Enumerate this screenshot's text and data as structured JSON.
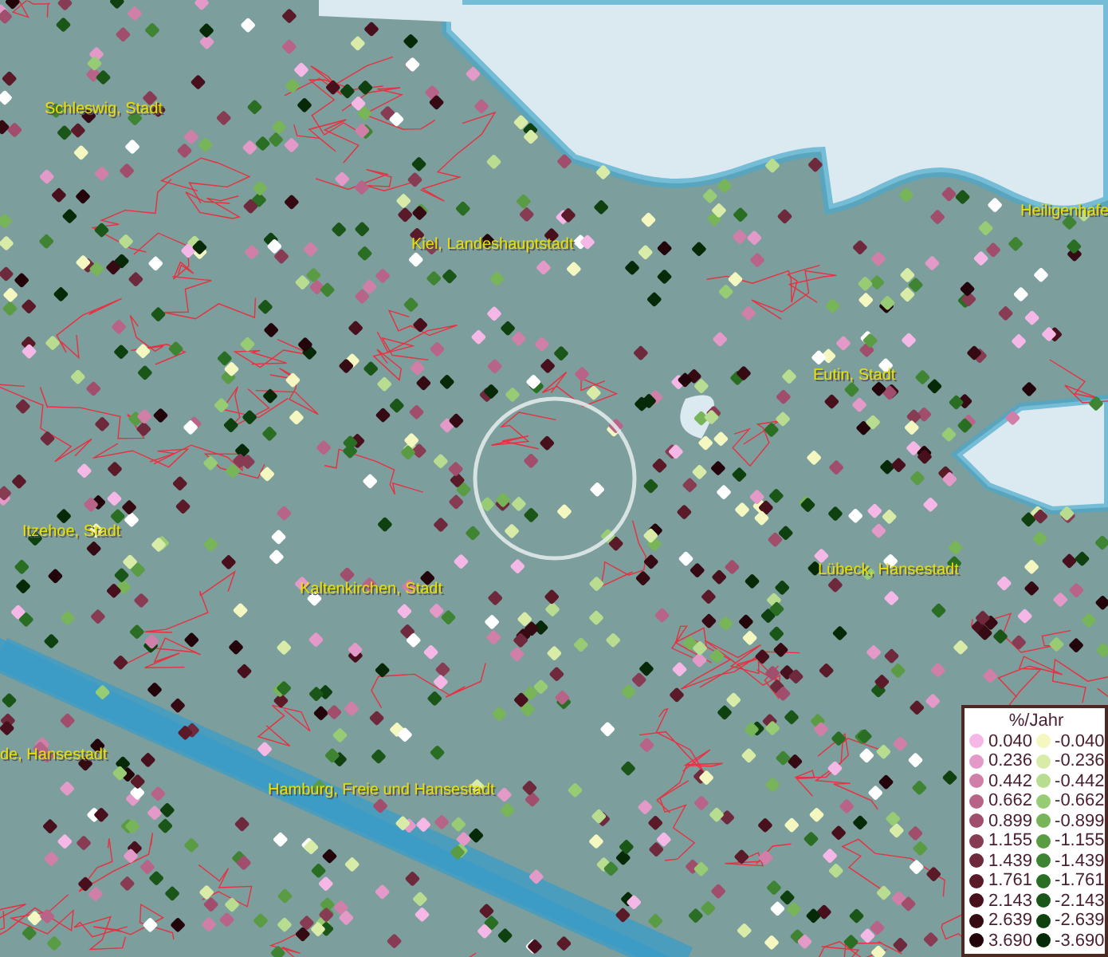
{
  "map": {
    "places": [
      {
        "name": "Schleswig, Stadt"
      },
      {
        "name": "Kiel, Landeshauptstadt"
      },
      {
        "name": "Heiligenhafe"
      },
      {
        "name": "Eutin, Stadt"
      },
      {
        "name": "Itzehoe, Stadt"
      },
      {
        "name": "Kaltenkirchen, Stadt"
      },
      {
        "name": "Lübeck, Hansestadt"
      },
      {
        "name": "de, Hansestadt"
      },
      {
        "name": "Hamburg, Freie und Hansestadt"
      }
    ]
  },
  "legend": {
    "title": "%/Jahr",
    "positive": [
      {
        "value": "0.040",
        "color": "#f5b8e6"
      },
      {
        "value": "0.236",
        "color": "#e49ac8"
      },
      {
        "value": "0.442",
        "color": "#d080a8"
      },
      {
        "value": "0.662",
        "color": "#b86488"
      },
      {
        "value": "0.899",
        "color": "#a04e6c"
      },
      {
        "value": "1.155",
        "color": "#883c54"
      },
      {
        "value": "1.439",
        "color": "#6e2a3c"
      },
      {
        "value": "1.761",
        "color": "#5a1a28"
      },
      {
        "value": "2.143",
        "color": "#48101c"
      },
      {
        "value": "2.639",
        "color": "#360a12"
      },
      {
        "value": "3.690",
        "color": "#22040a"
      }
    ],
    "negative": [
      {
        "value": "-0.040",
        "color": "#f4f8c0"
      },
      {
        "value": "-0.236",
        "color": "#d8eca8"
      },
      {
        "value": "-0.442",
        "color": "#b8dc90"
      },
      {
        "value": "-0.662",
        "color": "#98cc74"
      },
      {
        "value": "-0.899",
        "color": "#78b458"
      },
      {
        "value": "-1.155",
        "color": "#5a9c44"
      },
      {
        "value": "-1.439",
        "color": "#3e8432"
      },
      {
        "value": "-1.761",
        "color": "#2a6e24"
      },
      {
        "value": "-2.143",
        "color": "#1a5618"
      },
      {
        "value": "-2.639",
        "color": "#0e4010"
      },
      {
        "value": "-3.690",
        "color": "#062a08"
      }
    ]
  }
}
